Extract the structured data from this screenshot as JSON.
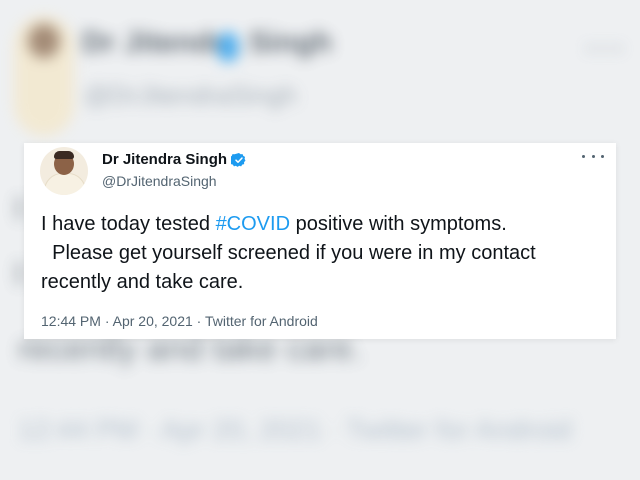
{
  "tweet": {
    "author_name": "Dr Jitendra Singh",
    "handle": "@DrJitendraSingh",
    "text_line1_before": "I have today tested ",
    "hashtag": "#COVID",
    "text_line1_after": " positive with symptoms.",
    "text_line2": "  Please get yourself screened if you were in my contact",
    "text_line3": "recently and take care.",
    "time": "12:44 PM",
    "separator": " · ",
    "date": "Apr 20, 2021",
    "source": "Twitter for Android"
  },
  "background": {
    "line1": "I",
    "line2": "I",
    "line3": "recently and take care.",
    "meta": "12:44 PM · Apr 20, 2021 · Twitter for Android"
  },
  "icons": {
    "verified": "verified-badge-icon",
    "more": "more-options-icon"
  },
  "colors": {
    "link": "#1d9bf0",
    "text": "#0f1419",
    "muted": "#536471",
    "background": "#eef0f2"
  }
}
